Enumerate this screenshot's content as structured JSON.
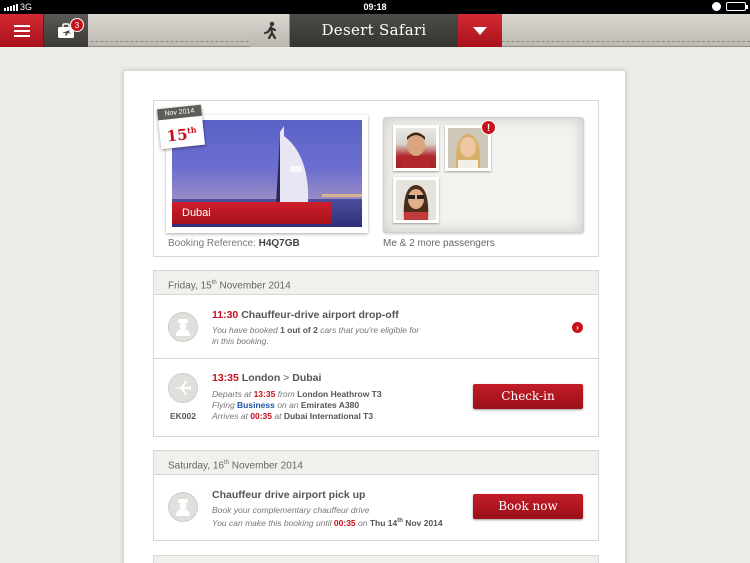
{
  "status_bar": {
    "carrier": "3G",
    "time": "09:18"
  },
  "nav": {
    "trips_badge": "3",
    "title": "Desert Safari"
  },
  "booking": {
    "date_month": "Nov 2014",
    "date_day": "15",
    "date_suffix": "th",
    "destination": "Dubai",
    "reference_label": "Booking Reference:",
    "reference_code": "H4Q7GB",
    "passengers_text": "Me & 2 more passengers",
    "alert_mark": "!"
  },
  "days": [
    {
      "prefix": "Friday, 15",
      "suffix": "th",
      "rest": " November 2014",
      "items": [
        {
          "time": "11:30",
          "title": "Chauffeur-drive airport drop-off",
          "sub1_a": "You have booked ",
          "sub1_b": "1 out of 2",
          "sub1_c": " cars that you're eligible for",
          "sub2": "in this booking."
        },
        {
          "time": "13:35",
          "from": "London",
          "arrow": " > ",
          "to": "Dubai",
          "flight_code": "EK002",
          "departs_a": "Departs at ",
          "departs_time": "13:35",
          "departs_b": " from ",
          "departs_place": "London Heathrow T3",
          "flying_a": "Flying ",
          "flying_class": "Business",
          "flying_b": " on an ",
          "flying_plane": "Emirates A380",
          "arrives_a": "Arrives at ",
          "arrives_time": "00:35",
          "arrives_b": " at ",
          "arrives_place": "Dubai International T3",
          "button": "Check-in"
        }
      ]
    },
    {
      "prefix": "Saturday, 16",
      "suffix": "th",
      "rest": " November 2014",
      "items": [
        {
          "title": "Chauffeur drive airport pick up",
          "sub1": "Book your complementary chauffeur drive",
          "sub2_a": "You can make this booking until ",
          "sub2_time": "00:35",
          "sub2_b": " on ",
          "sub2_date": "Thu 14",
          "sub2_sup": "th",
          "sub2_c": " Nov 2014",
          "button": "Book now"
        }
      ]
    }
  ],
  "colors": {
    "accent": "#c8101a",
    "nav_dark": "#3c3a36",
    "background": "#ecebe6"
  },
  "icons": [
    "signal-icon",
    "menu-icon",
    "trips-icon",
    "walker-icon",
    "dropdown-icon",
    "chauffeur-icon",
    "plane-icon",
    "chevron-right-icon",
    "clock-icon",
    "battery-icon"
  ]
}
